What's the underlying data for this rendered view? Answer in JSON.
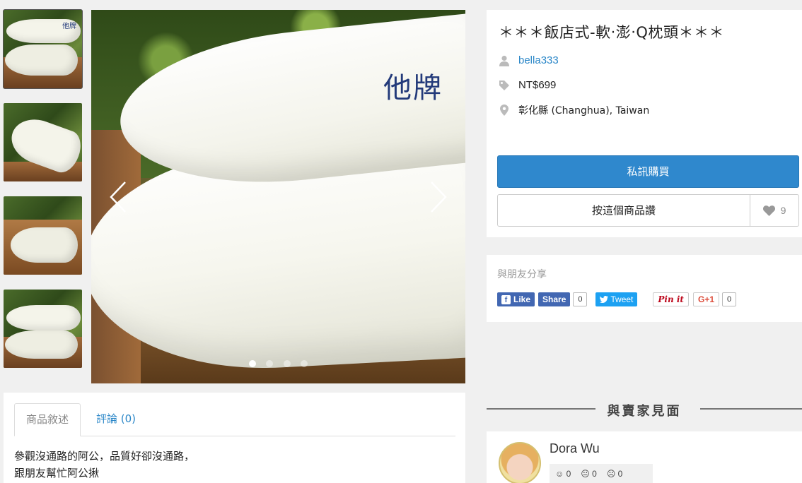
{
  "gallery": {
    "thumb_brand": "他牌",
    "hero_brand": "他牌",
    "dot_count": 4,
    "active_dot": 0
  },
  "product": {
    "title": "＊＊＊飯店式-軟‧澎‧Q枕頭＊＊＊",
    "seller": "bella333",
    "price": "NT$699",
    "location": "彰化縣 (Changhua), Taiwan",
    "buy_label": "私訊購買",
    "like_label": "按這個商品讚",
    "like_count": "9"
  },
  "share": {
    "title": "與朋友分享",
    "fb_like": "Like",
    "fb_share": "Share",
    "fb_count": "0",
    "tweet": "Tweet",
    "pin": "Pin it",
    "gplus": "G+1",
    "gplus_count": "0"
  },
  "meet": {
    "heading": "與賣家見面",
    "seller_name": "Dora Wu",
    "positive": "0",
    "neutral": "0",
    "negative": "0"
  },
  "tabs": {
    "description": "商品敘述",
    "reviews": "評論 (0)"
  },
  "description": {
    "line1": "參觀沒通路的阿公，品質好卻沒通路，",
    "line2": "跟朋友幫忙阿公揪"
  },
  "colors": {
    "accent": "#2f88cd",
    "link": "#2b87c8",
    "facebook": "#4267b2",
    "twitter": "#1da1f2"
  }
}
